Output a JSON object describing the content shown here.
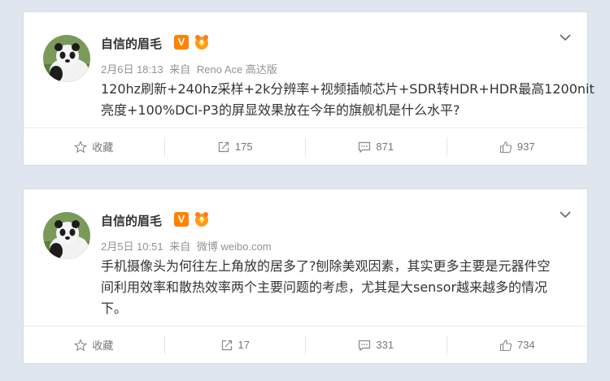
{
  "posts": [
    {
      "author": "自信的眉毛",
      "verified_mark": "V",
      "date": "2月6日 18:13",
      "source_prefix": "来自",
      "source": "Reno Ace 高达版",
      "content_lines": [
        "120hz刷新+240hz采样+2k分辨率+视频插帧芯片+SDR转HDR+HDR最高1200nit",
        "亮度+100%DCI-P3的屏显效果放在今年的旗舰机是什么水平?"
      ],
      "actions": {
        "favorite_label": "收藏",
        "repost_count": "175",
        "comment_count": "871",
        "like_count": "937"
      }
    },
    {
      "author": "自信的眉毛",
      "verified_mark": "V",
      "date": "2月5日 10:51",
      "source_prefix": "来自",
      "source": "微博 weibo.com",
      "content_lines": [
        "手机摄像头为何往左上角放的居多了?刨除美观因素，其实更多主要是元器件空",
        "间利用效率和散热效率两个主要问题的考虑，尤其是大sensor越来越多的情况",
        "下。"
      ],
      "actions": {
        "favorite_label": "收藏",
        "repost_count": "17",
        "comment_count": "331",
        "like_count": "734"
      }
    }
  ],
  "icons": {
    "favorite": "star-icon",
    "repost": "repost-icon",
    "comment": "comment-icon",
    "like": "thumbs-up-icon",
    "menu": "chevron-down-icon",
    "verified": "verified-v-icon",
    "fan_badge": "fan-badge-icon"
  },
  "colors": {
    "background": "#dfe6ef",
    "verified_orange": "#ff8200",
    "meta_gray": "#939393",
    "text": "#333333"
  }
}
